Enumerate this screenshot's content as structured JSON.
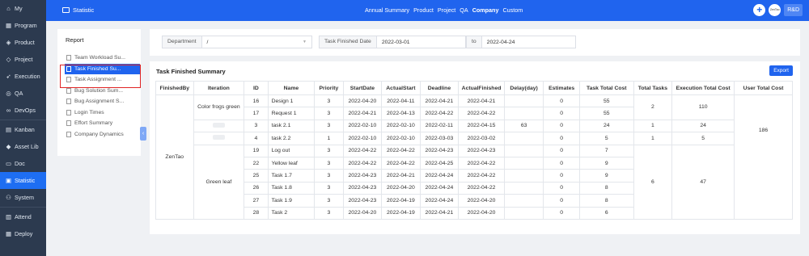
{
  "leftnav": {
    "items": [
      {
        "label": "My",
        "icon": "⌂",
        "icon_name": "home-icon"
      },
      {
        "label": "Program",
        "icon": "▦",
        "icon_name": "program-icon"
      },
      {
        "label": "Product",
        "icon": "◈",
        "icon_name": "product-icon"
      },
      {
        "label": "Project",
        "icon": "◇",
        "icon_name": "project-icon"
      },
      {
        "label": "Execution",
        "icon": "➶",
        "icon_name": "execution-icon"
      },
      {
        "label": "QA",
        "icon": "◎",
        "icon_name": "qa-icon"
      },
      {
        "label": "DevOps",
        "icon": "∞",
        "icon_name": "devops-icon"
      },
      {
        "label": "Kanban",
        "icon": "▤",
        "icon_name": "kanban-icon"
      },
      {
        "label": "Asset Lib",
        "icon": "◆",
        "icon_name": "asset-lib-icon"
      },
      {
        "label": "Doc",
        "icon": "▭",
        "icon_name": "doc-icon"
      },
      {
        "label": "Statistic",
        "icon": "▣",
        "icon_name": "statistic-icon"
      },
      {
        "label": "System",
        "icon": "⚇",
        "icon_name": "system-icon"
      },
      {
        "label": "Attend",
        "icon": "▥",
        "icon_name": "attend-icon"
      },
      {
        "label": "Deploy",
        "icon": "▦",
        "icon_name": "deploy-icon"
      }
    ],
    "active": "Statistic"
  },
  "header": {
    "title": "Statistic",
    "nav": [
      "Annual Summary",
      "Product",
      "Project",
      "QA",
      "Company",
      "Custom"
    ],
    "active_nav": "Company",
    "avatar_text": "ZenTao",
    "role_button": "R&D",
    "accent_color": "#2064ee"
  },
  "report": {
    "title": "Report",
    "items": [
      "Team Workload Su...",
      "Task Finished Su...",
      "Task Assignment ...",
      "Bug Solution Sum...",
      "Bug Assignment S...",
      "Login Times",
      "Effort Summary",
      "Company Dynamics"
    ],
    "active_index": 1
  },
  "filter": {
    "department_label": "Department",
    "department_value": "/",
    "date_label": "Task Finished Date",
    "date_from": "2022-03-01",
    "to_label": "to",
    "date_to": "2022-04-24"
  },
  "summary": {
    "title": "Task Finished Summary",
    "export_label": "Export",
    "columns": [
      "FinishedBy",
      "Iteration",
      "ID",
      "Name",
      "Priority",
      "StartDate",
      "ActualStart",
      "Deadline",
      "ActualFinished",
      "Delay(day)",
      "Estimates",
      "Task Total Cost",
      "Total Tasks",
      "Execution Total Cost",
      "User Total Cost"
    ],
    "finished_by": "ZenTao",
    "user_total_cost": "186",
    "groups": [
      {
        "iteration": "Color frogs green",
        "blurred": false,
        "total_tasks": "2",
        "exec_cost": "110",
        "rows": [
          [
            "16",
            "Design 1",
            "3",
            "2022-04-20",
            "2022-04-11",
            "2022-04-21",
            "2022-04-21",
            "",
            "0",
            "55"
          ],
          [
            "17",
            "Request 1",
            "3",
            "2022-04-21",
            "2022-04-13",
            "2022-04-22",
            "2022-04-22",
            "",
            "0",
            "55"
          ]
        ]
      },
      {
        "iteration": "",
        "blurred": true,
        "total_tasks": "1",
        "exec_cost": "24",
        "rows": [
          [
            "3",
            "task 2.1",
            "3",
            "2022-02-10",
            "2022-02-10",
            "2022-02-11",
            "2022-04-15",
            "63",
            "0",
            "24"
          ]
        ]
      },
      {
        "iteration": "",
        "blurred": true,
        "total_tasks": "1",
        "exec_cost": "5",
        "rows": [
          [
            "4",
            "task 2.2",
            "1",
            "2022-02-10",
            "2022-02-10",
            "2022-03-03",
            "2022-03-02",
            "",
            "0",
            "5"
          ]
        ]
      },
      {
        "iteration": "Green leaf",
        "blurred": false,
        "total_tasks": "6",
        "exec_cost": "47",
        "rows": [
          [
            "19",
            "Log out",
            "3",
            "2022-04-22",
            "2022-04-22",
            "2022-04-23",
            "2022-04-23",
            "",
            "0",
            "7"
          ],
          [
            "22",
            "Yellow leaf",
            "3",
            "2022-04-22",
            "2022-04-22",
            "2022-04-25",
            "2022-04-22",
            "",
            "0",
            "9"
          ],
          [
            "25",
            "Task 1.7",
            "3",
            "2022-04-23",
            "2022-04-21",
            "2022-04-24",
            "2022-04-22",
            "",
            "0",
            "9"
          ],
          [
            "26",
            "Task 1.8",
            "3",
            "2022-04-23",
            "2022-04-20",
            "2022-04-24",
            "2022-04-22",
            "",
            "0",
            "8"
          ],
          [
            "27",
            "Task 1.9",
            "3",
            "2022-04-23",
            "2022-04-19",
            "2022-04-24",
            "2022-04-20",
            "",
            "0",
            "8"
          ],
          [
            "28",
            "Task 2",
            "3",
            "2022-04-20",
            "2022-04-19",
            "2022-04-21",
            "2022-04-20",
            "",
            "0",
            "6"
          ]
        ]
      }
    ]
  }
}
